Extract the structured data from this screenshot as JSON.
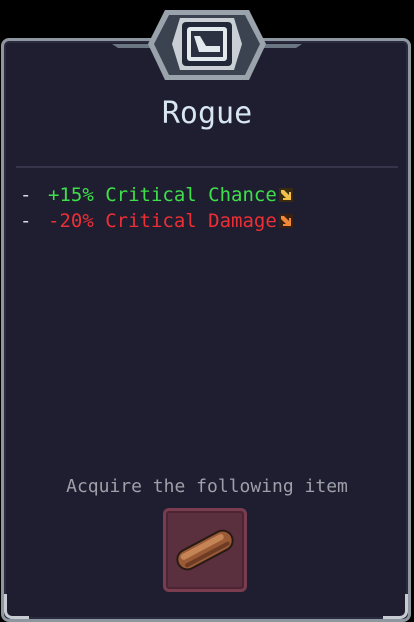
{
  "class_card": {
    "title": "Rogue",
    "emblem_icon": "dagger-emblem-icon"
  },
  "stats": [
    {
      "prefix": "-",
      "text": "+15% Critical Chance",
      "color": "#3ee04a",
      "arrow": "arrow-icon"
    },
    {
      "prefix": "-",
      "text": "-20% Critical Damage",
      "color": "#ec2f34",
      "arrow": "arrow-icon"
    }
  ],
  "reward": {
    "label": "Acquire the following item",
    "item_icon": "sausage-icon"
  }
}
